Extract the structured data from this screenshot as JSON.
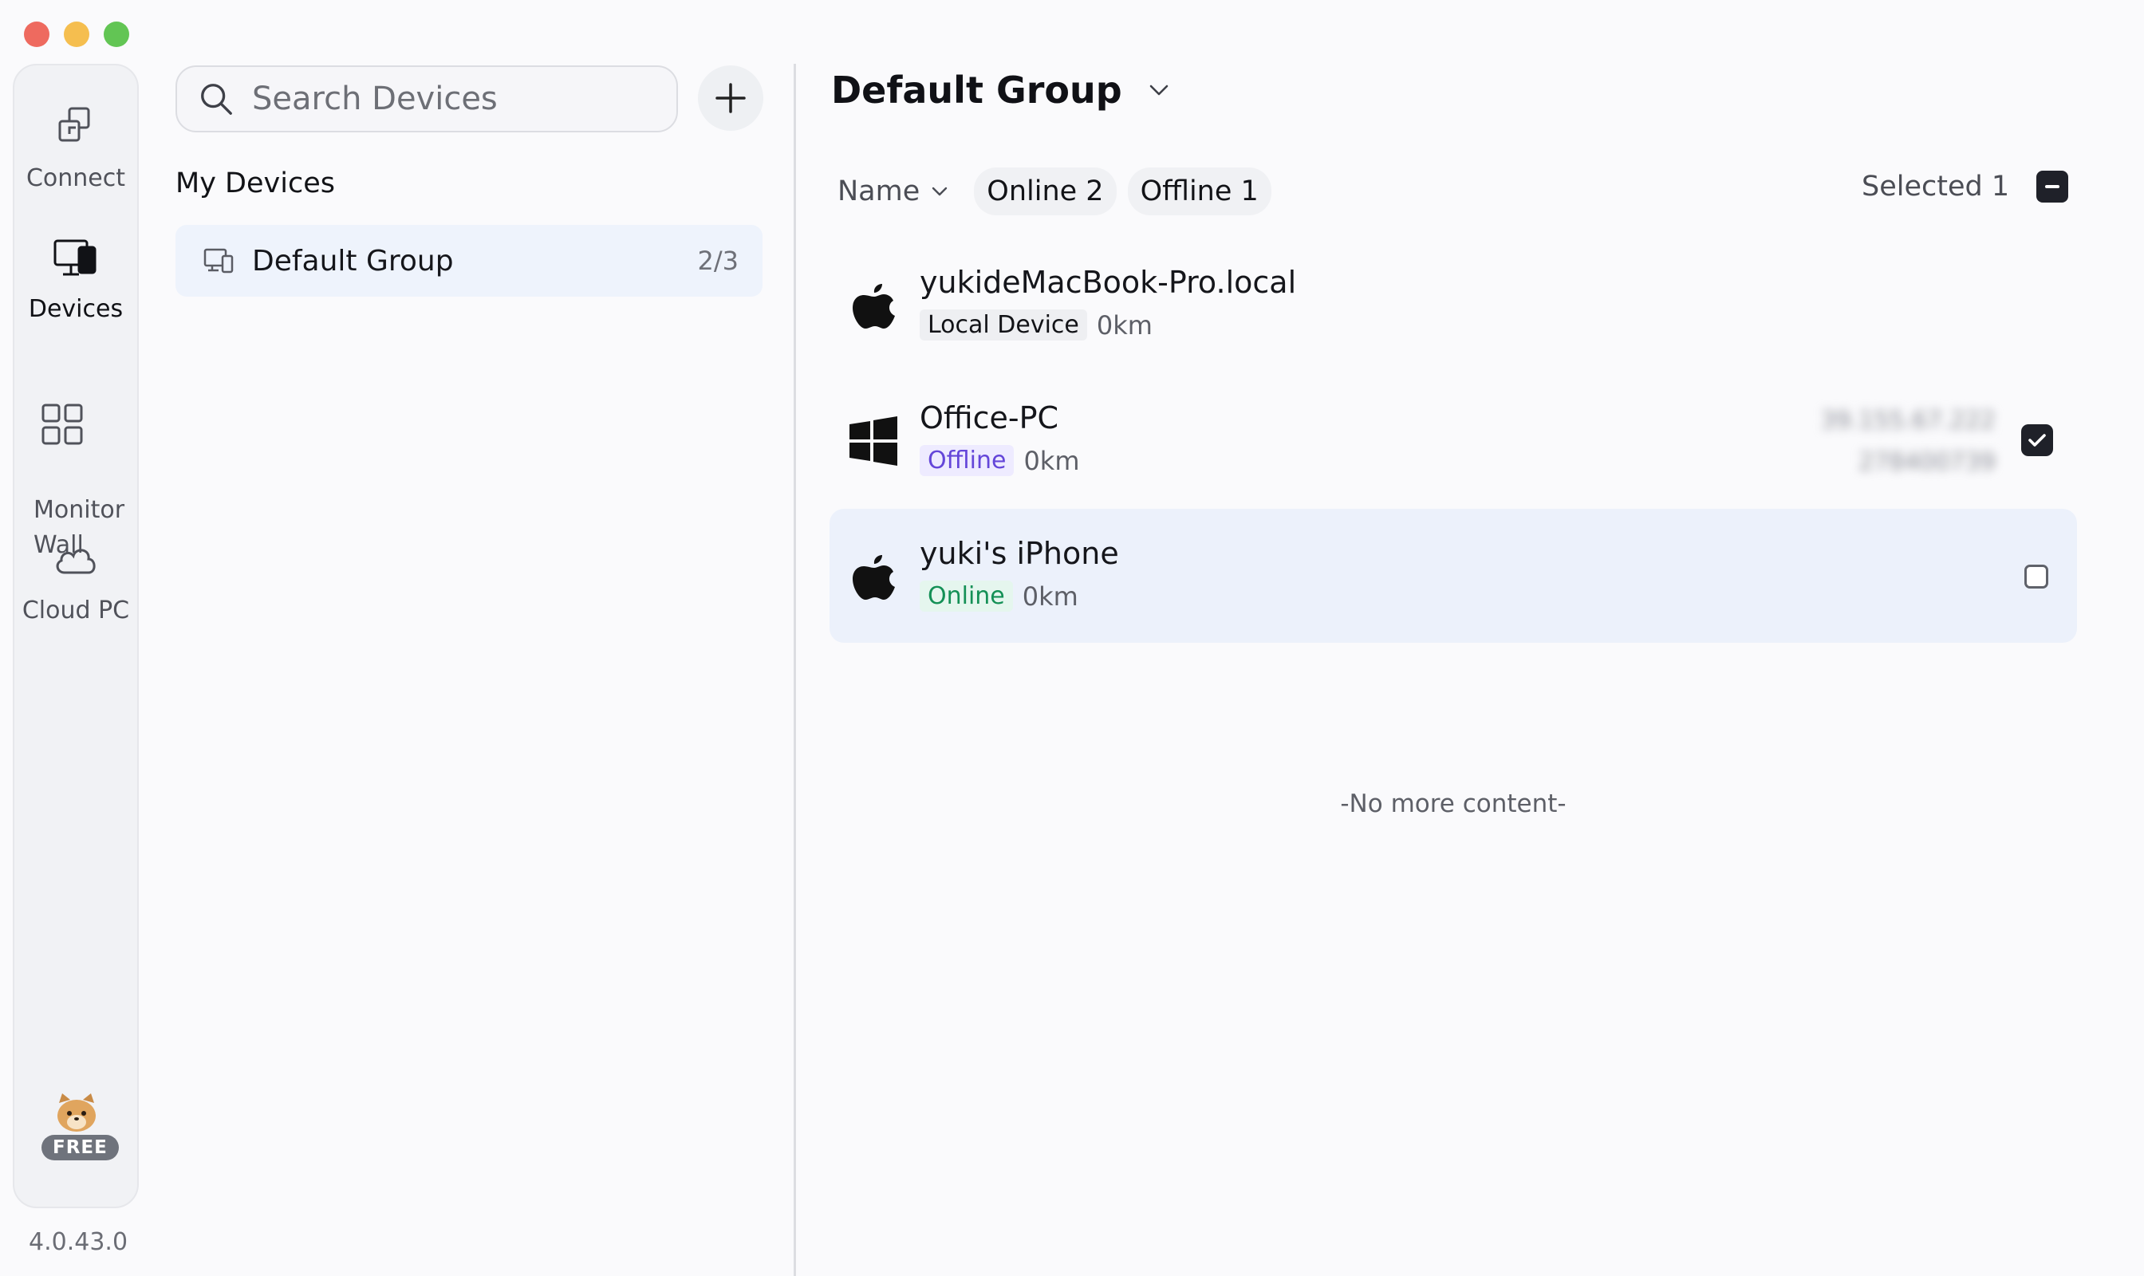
{
  "window": {
    "version": "4.0.43.0"
  },
  "nav": {
    "items": [
      {
        "id": "connect",
        "label": "Connect",
        "icon": "connect-icon"
      },
      {
        "id": "devices",
        "label": "Devices",
        "icon": "devices-icon",
        "active": true
      },
      {
        "id": "monitor-wall",
        "label": "Monitor\nWall",
        "icon": "grid-icon"
      },
      {
        "id": "cloud-pc",
        "label": "Cloud PC",
        "icon": "cloud-icon"
      }
    ],
    "badge_label": "FREE"
  },
  "sidebar": {
    "search_placeholder": "Search Devices",
    "section_title": "My Devices",
    "groups": [
      {
        "label": "Default Group",
        "count": "2/3"
      }
    ]
  },
  "main": {
    "group_title": "Default Group",
    "sort_label": "Name",
    "chips": [
      "Online 2",
      "Offline 1"
    ],
    "selected_label": "Selected 1",
    "devices": [
      {
        "name": "yukideMacBook-Pro.local",
        "os": "apple-icon",
        "tag": "Local Device",
        "tag_type": "local",
        "distance": "0km",
        "checked": null
      },
      {
        "name": "Office-PC",
        "os": "windows-icon",
        "tag": "Offline",
        "tag_type": "offline",
        "distance": "0km",
        "checked": true,
        "blurred_lines": [
          "39.155.67.222",
          "278400739"
        ]
      },
      {
        "name": "yuki's iPhone",
        "os": "apple-icon",
        "tag": "Online",
        "tag_type": "online",
        "distance": "0km",
        "checked": false
      }
    ],
    "end_text": "-No more content-"
  },
  "colors": {
    "accent_dark": "#1f2129",
    "online_green": "#149056",
    "offline_purple": "#6446d9",
    "row_highlight": "#ecf1fb"
  }
}
